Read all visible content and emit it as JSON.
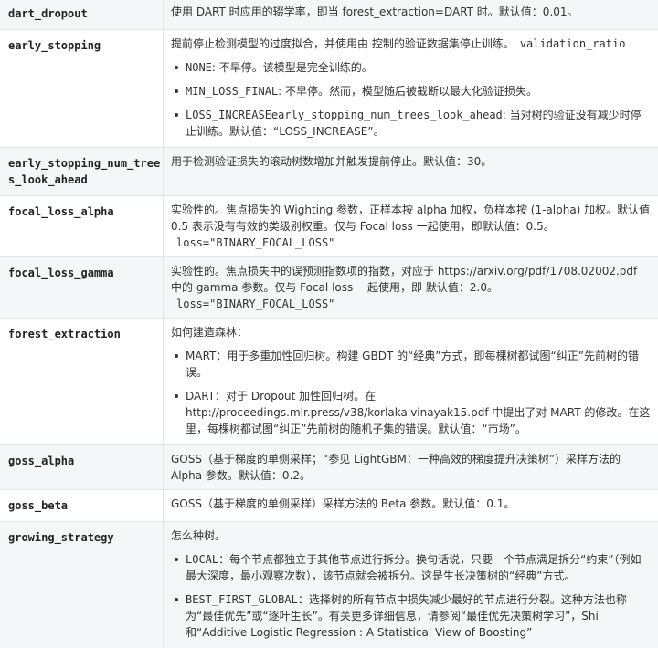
{
  "rows": [
    {
      "name": "dart_dropout",
      "desc": "使用 DART 时应用的辍学率，即当 forest_extraction=DART 时。默认值：0.01。"
    },
    {
      "name": "early_stopping",
      "desc": "提前停止检测模型的过度拟合，并使用由 控制的验证数据集停止训练。",
      "code": "validation_ratio",
      "bullets": [
        {
          "code": "NONE",
          "text": ": 不早停。该模型是完全训练的。"
        },
        {
          "code": "MIN_LOSS_FINAL",
          "text": ": 不早停。然而，模型随后被截断以最大化验证损失。"
        },
        {
          "code": "LOSS_INCREASEearly_stopping_num_trees_look_ahead",
          "text": ": 当对树的验证没有减少时停止训练。默认值：“LOSS_INCREASE”。"
        }
      ]
    },
    {
      "name": "early_stopping_num_trees_look_ahead",
      "desc": "用于检测验证损失的滚动树数增加并触发提前停止。默认值：30。"
    },
    {
      "name": "focal_loss_alpha",
      "desc": "实验性的。焦点损失的 Wighting 参数，正样本按 alpha 加权，负样本按 (1-alpha) 加权。默认值 0.5 表示没有有效的类级别权重。仅与 Focal loss 一起使用，即默认值：0.5。",
      "code": "loss=\"BINARY_FOCAL_LOSS\""
    },
    {
      "name": "focal_loss_gamma",
      "desc": "实验性的。焦点损失中的误预测指数项的指数，对应于 https://arxiv.org/pdf/1708.02002.pdf 中的 gamma 参数。仅与 Focal loss 一起使用，即 默认值：2.0。",
      "code": "loss=\"BINARY_FOCAL_LOSS\""
    },
    {
      "name": "forest_extraction",
      "desc": "如何建造森林：",
      "bullets": [
        {
          "code": "",
          "text": "MART：用于多重加性回归树。构建 GBDT 的“经典”方式，即每棵树都试图“纠正”先前树的错误。"
        },
        {
          "code": "",
          "text": "DART：对于 Dropout 加性回归树。在 http://proceedings.mlr.press/v38/korlakaivinayak15.pdf 中提出了对 MART 的修改。在这里，每棵树都试图“纠正”先前树的随机子集的错误。默认值：“市场”。"
        }
      ]
    },
    {
      "name": "goss_alpha",
      "desc": "GOSS（基于梯度的单侧采样；“参见 LightGBM：一种高效的梯度提升决策树”）采样方法的 Alpha 参数。默认值：0.2。"
    },
    {
      "name": "goss_beta",
      "desc": "GOSS（基于梯度的单侧采样）采样方法的 Beta 参数。默认值：0.1。"
    },
    {
      "name": "growing_strategy",
      "desc": "怎么种树。",
      "bullets": [
        {
          "code": "LOCAL",
          "text": "：每个节点都独立于其他节点进行拆分。换句话说，只要一个节点满足拆分“约束”（例如最大深度，最小观察次数），该节点就会被拆分。这是生长决策树的“经典”方式。"
        },
        {
          "code": "BEST_FIRST_GLOBAL",
          "text": "：选择树的所有节点中损失减少最好的节点进行分裂。这种方法也称为“最佳优先”或“逐叶生长”。有关更多详细信息，请参阅“最佳优先决策树学习”，Shi 和“Additive Logistic Regression : A Statistical View of Boosting”"
        }
      ]
    }
  ]
}
